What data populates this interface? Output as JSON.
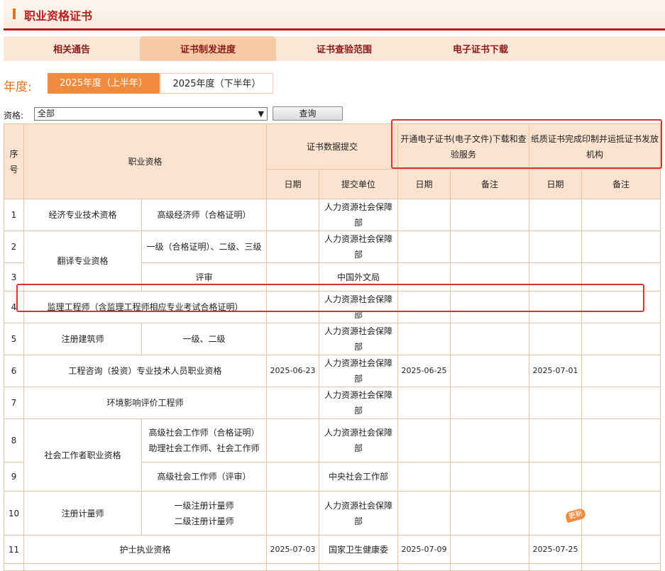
{
  "header": {
    "title": "职业资格证书"
  },
  "tabs": [
    {
      "label": "相关通告"
    },
    {
      "label": "证书制发进度"
    },
    {
      "label": "证书查验范围"
    },
    {
      "label": "电子证书下载"
    }
  ],
  "year": {
    "label": "年度:",
    "options": [
      "2025年度（上半年）",
      "2025年度（下半年）"
    ],
    "selected": "2025年度（上半年）"
  },
  "filter": {
    "label": "资格:",
    "select_value": "全部",
    "query_button": "查询"
  },
  "table": {
    "headers": {
      "index": "序号",
      "qualification": "职业资格",
      "data_submit": "证书数据提交",
      "electronic": "开通电子证书(电子文件)下载和查验服务",
      "paper": "纸质证书完成印制并运抵证书发放机构",
      "date": "日期",
      "unit": "提交单位",
      "remark": "备注"
    },
    "rows": [
      {
        "no": "1",
        "group": "经济专业技术资格",
        "sub": "高级经济师（合格证明）",
        "submit_date": "",
        "unit": "人力资源社会保障部",
        "e_date": "",
        "e_remark": "",
        "p_date": "",
        "p_remark": ""
      },
      {
        "no": "2",
        "group": "翻译专业资格",
        "sub": "一级（合格证明）、二级、三级",
        "submit_date": "",
        "unit": "人力资源社会保障部",
        "e_date": "",
        "e_remark": "",
        "p_date": "",
        "p_remark": ""
      },
      {
        "no": "3",
        "group": "",
        "sub": "评审",
        "submit_date": "",
        "unit": "中国外文局",
        "e_date": "",
        "e_remark": "",
        "p_date": "",
        "p_remark": ""
      },
      {
        "no": "4",
        "group": "监理工程师（含监理工程师相应专业考试合格证明）",
        "sub": "",
        "submit_date": "",
        "unit": "人力资源社会保障部",
        "e_date": "",
        "e_remark": "",
        "p_date": "",
        "p_remark": ""
      },
      {
        "no": "5",
        "group": "注册建筑师",
        "sub": "一级、二级",
        "submit_date": "",
        "unit": "人力资源社会保障部",
        "e_date": "",
        "e_remark": "",
        "p_date": "",
        "p_remark": ""
      },
      {
        "no": "6",
        "group": "工程咨询（投资）专业技术人员职业资格",
        "sub": "",
        "submit_date": "2025-06-23",
        "unit": "人力资源社会保障部",
        "e_date": "2025-06-25",
        "e_remark": "",
        "p_date": "2025-07-01",
        "p_remark": ""
      },
      {
        "no": "7",
        "group": "环境影响评价工程师",
        "sub": "",
        "submit_date": "",
        "unit": "人力资源社会保障部",
        "e_date": "",
        "e_remark": "",
        "p_date": "",
        "p_remark": ""
      },
      {
        "no": "8",
        "group": "社会工作者职业资格",
        "sub": "高级社会工作师（合格证明）",
        "sub2": "助理社会工作师、社会工作师",
        "submit_date": "",
        "unit": "人力资源社会保障部",
        "e_date": "",
        "e_remark": "",
        "p_date": "",
        "p_remark": ""
      },
      {
        "no": "9",
        "group": "",
        "sub": "高级社会工作师（评审）",
        "submit_date": "",
        "unit": "中央社会工作部",
        "e_date": "",
        "e_remark": "",
        "p_date": "",
        "p_remark": ""
      },
      {
        "no": "10",
        "group": "注册计量师",
        "sub": "一级注册计量师",
        "sub2": "二级注册计量师",
        "submit_date": "",
        "unit": "人力资源社会保障部",
        "e_date": "",
        "e_remark": "",
        "p_date": "",
        "p_remark": ""
      },
      {
        "no": "11",
        "group": "护士执业资格",
        "sub": "",
        "submit_date": "2025-07-03",
        "unit": "国家卫生健康委",
        "e_date": "2025-07-09",
        "e_remark": "",
        "p_date": "2025-07-25",
        "p_remark": ""
      }
    ],
    "update_badge": "更新"
  },
  "colors": {
    "accent": "#e5711a",
    "brand_red": "#b81c1c",
    "highlight_box": "#e03030",
    "header_bg": "#fbe3cf"
  }
}
